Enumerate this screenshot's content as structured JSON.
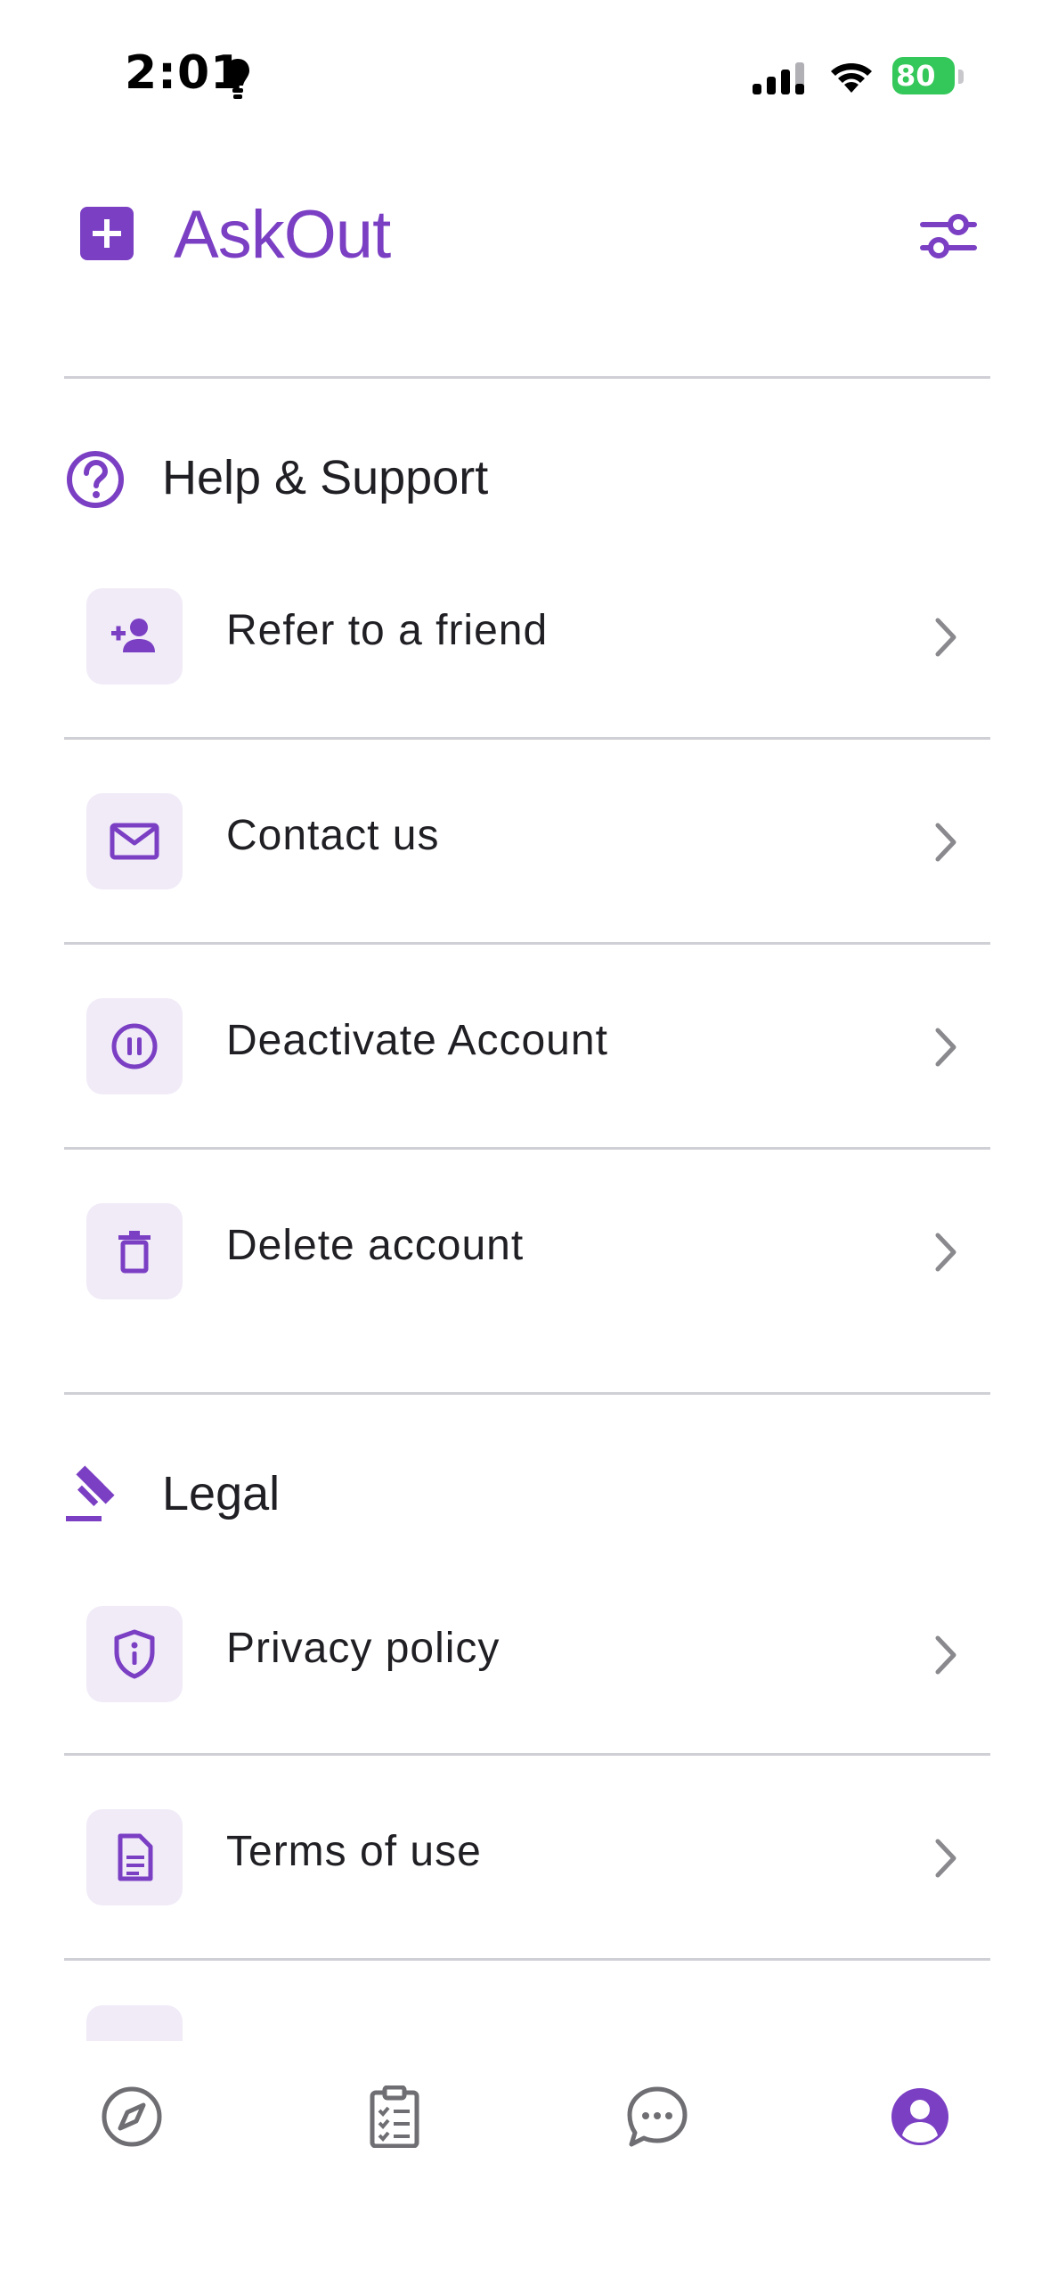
{
  "status_bar": {
    "time": "2:01",
    "battery": "80"
  },
  "header": {
    "title": "AskOut"
  },
  "sections": {
    "help": {
      "title": "Help & Support",
      "items": [
        {
          "label": "Refer to a friend",
          "icon": "person-add-icon"
        },
        {
          "label": "Contact us",
          "icon": "mail-icon"
        },
        {
          "label": "Deactivate Account",
          "icon": "pause-circle-icon"
        },
        {
          "label": "Delete account",
          "icon": "trash-icon"
        }
      ]
    },
    "legal": {
      "title": "Legal",
      "items": [
        {
          "label": "Privacy policy",
          "icon": "shield-info-icon"
        },
        {
          "label": "Terms of use",
          "icon": "document-icon"
        }
      ]
    }
  },
  "tab_bar": {
    "tabs": [
      {
        "name": "explore",
        "icon": "compass-icon"
      },
      {
        "name": "tasks",
        "icon": "clipboard-checklist-icon"
      },
      {
        "name": "messages",
        "icon": "chat-bubble-icon"
      },
      {
        "name": "profile",
        "icon": "user-circle-icon",
        "active": true
      }
    ]
  },
  "colors": {
    "accent": "#7b3fc4",
    "icon_bg": "#f1ebf8",
    "divider": "#cfcfd6",
    "inactive_icon": "#6e6e73",
    "battery": "#34c759"
  }
}
